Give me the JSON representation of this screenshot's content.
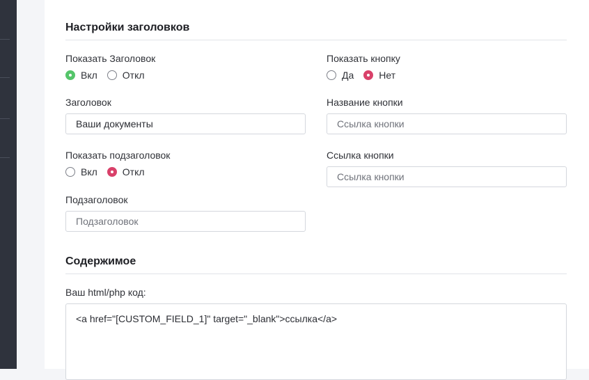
{
  "headers_section": {
    "title": "Настройки заголовков",
    "show_title": {
      "label": "Показать Заголовок",
      "options": [
        {
          "label": "Вкл",
          "selected": true
        },
        {
          "label": "Откл",
          "selected": false
        }
      ]
    },
    "title_field": {
      "label": "Заголовок",
      "value": "Ваши документы",
      "placeholder": ""
    },
    "show_subtitle": {
      "label": "Показать подзаголовок",
      "options": [
        {
          "label": "Вкл",
          "selected": false
        },
        {
          "label": "Откл",
          "selected": true
        }
      ]
    },
    "subtitle_field": {
      "label": "Подзаголовок",
      "value": "",
      "placeholder": "Подзаголовок"
    },
    "show_button": {
      "label": "Показать кнопку",
      "options": [
        {
          "label": "Да",
          "selected": false
        },
        {
          "label": "Нет",
          "selected": true
        }
      ]
    },
    "button_name_field": {
      "label": "Название кнопки",
      "value": "",
      "placeholder": "Ссылка кнопки"
    },
    "button_link_field": {
      "label": "Ссылка кнопки",
      "value": "",
      "placeholder": "Ссылка кнопки"
    }
  },
  "content_section": {
    "title": "Содержимое",
    "code_field": {
      "label": "Ваш html/php код:",
      "value": "<a href=\"[CUSTOM_FIELD_1]\" target=\"_blank\">ссылка</a>"
    }
  },
  "colors": {
    "radio_on_green": "#55c56a",
    "radio_on_red": "#d9416a",
    "sidebar": "#2f333d"
  }
}
